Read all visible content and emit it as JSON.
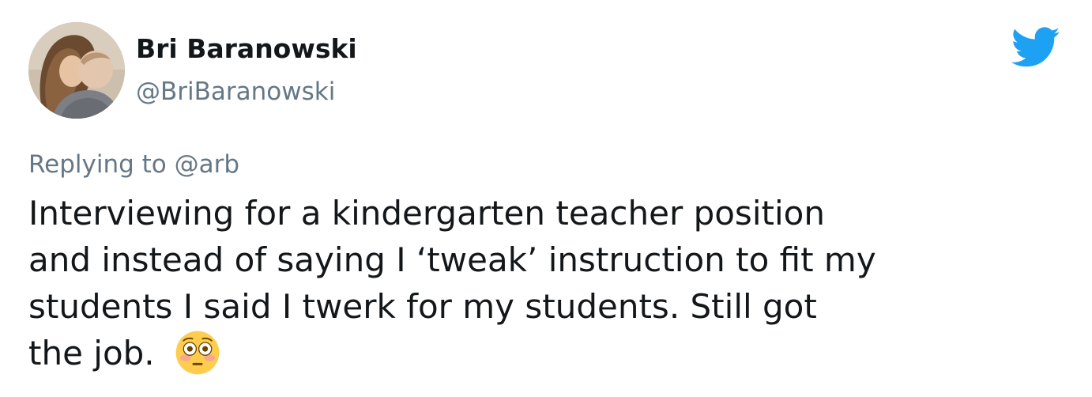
{
  "tweet": {
    "display_name": "Bri Baranowski",
    "handle": "@BriBaranowski",
    "replying_to": "Replying to @arb",
    "body_lines": [
      "Interviewing for a kindergarten teacher position",
      "and instead of saying I ‘tweak’ instruction to fit my",
      "students I said I twerk for my students. Still got",
      "the job."
    ],
    "emoji": "flushed-face"
  },
  "icons": {
    "brand": "twitter-bird-icon",
    "brand_color": "#1da1f2"
  }
}
